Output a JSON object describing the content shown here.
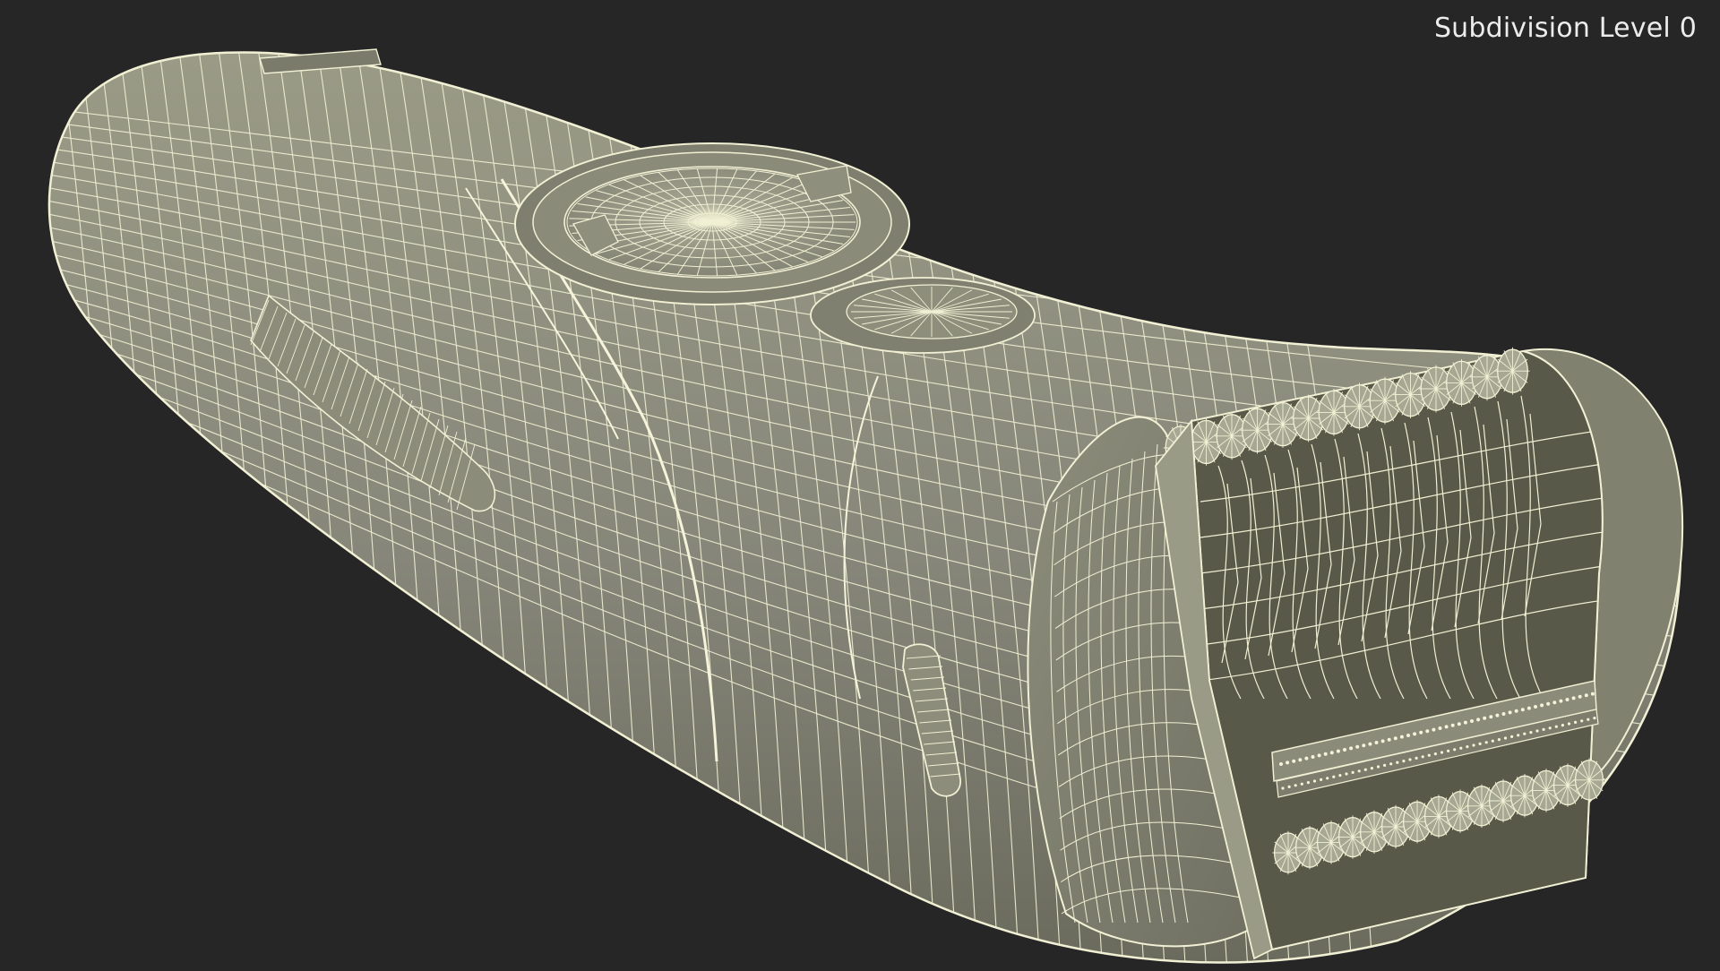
{
  "overlay": {
    "subdivision_label": "Subdivision Level 0"
  },
  "scene": {
    "background_color": "#262626",
    "surface_color": "#83846f",
    "wire_color": "#f1f0d4",
    "shadow_color": "#4c4c40"
  }
}
